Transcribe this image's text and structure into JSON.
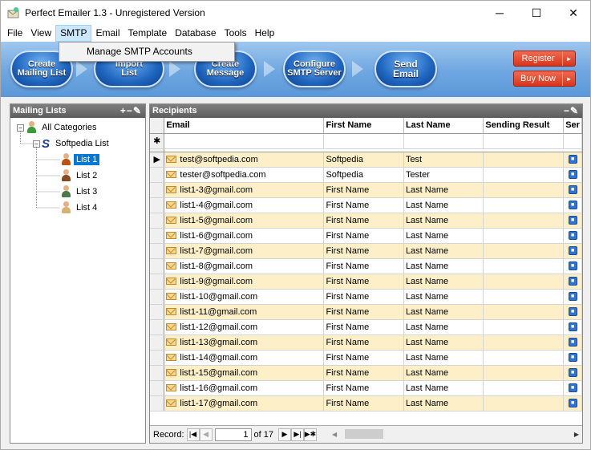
{
  "window": {
    "title": "Perfect Emailer 1.3 - Unregistered Version",
    "minimize": "─",
    "maximize": "☐",
    "close": "✕"
  },
  "menu": [
    "File",
    "View",
    "SMTP",
    "Email",
    "Template",
    "Database",
    "Tools",
    "Help"
  ],
  "smtp_dropdown": {
    "item": "Manage SMTP Accounts"
  },
  "toolbar": {
    "buttons": [
      "Create\nMailing List",
      "Import\nList",
      "Create\nMessage",
      "Configure\nSMTP Server",
      "Send\nEmail"
    ],
    "register": "Register",
    "buy_now": "Buy Now"
  },
  "mailing_lists": {
    "title": "Mailing Lists",
    "tools": "+−✎",
    "tree": {
      "root": "All Categories",
      "group": "Softpedia List",
      "lists": [
        "List 1",
        "List 2",
        "List 3",
        "List 4"
      ],
      "selected": "List 1"
    }
  },
  "recipients": {
    "title": "Recipients",
    "tools": "−✎",
    "columns": [
      "Email",
      "First Name",
      "Last Name",
      "Sending Result",
      "Ser"
    ],
    "new_row_marker": "✱",
    "current_row_marker": "▶",
    "rows": [
      {
        "email": "test@softpedia.com",
        "first": "Softpedia",
        "last": "Test"
      },
      {
        "email": "tester@softpedia.com",
        "first": "Softpedia",
        "last": "Tester"
      },
      {
        "email": "list1-3@gmail.com",
        "first": "First Name",
        "last": "Last Name"
      },
      {
        "email": "list1-4@gmail.com",
        "first": "First Name",
        "last": "Last Name"
      },
      {
        "email": "list1-5@gmail.com",
        "first": "First Name",
        "last": "Last Name"
      },
      {
        "email": "list1-6@gmail.com",
        "first": "First Name",
        "last": "Last Name"
      },
      {
        "email": "list1-7@gmail.com",
        "first": "First Name",
        "last": "Last Name"
      },
      {
        "email": "list1-8@gmail.com",
        "first": "First Name",
        "last": "Last Name"
      },
      {
        "email": "list1-9@gmail.com",
        "first": "First Name",
        "last": "Last Name"
      },
      {
        "email": "list1-10@gmail.com",
        "first": "First Name",
        "last": "Last Name"
      },
      {
        "email": "list1-11@gmail.com",
        "first": "First Name",
        "last": "Last Name"
      },
      {
        "email": "list1-12@gmail.com",
        "first": "First Name",
        "last": "Last Name"
      },
      {
        "email": "list1-13@gmail.com",
        "first": "First Name",
        "last": "Last Name"
      },
      {
        "email": "list1-14@gmail.com",
        "first": "First Name",
        "last": "Last Name"
      },
      {
        "email": "list1-15@gmail.com",
        "first": "First Name",
        "last": "Last Name"
      },
      {
        "email": "list1-16@gmail.com",
        "first": "First Name",
        "last": "Last Name"
      },
      {
        "email": "list1-17@gmail.com",
        "first": "First Name",
        "last": "Last Name"
      }
    ]
  },
  "navigator": {
    "label": "Record:",
    "current": "1",
    "of": "of 17",
    "first": "|◀",
    "prev": "◀",
    "next": "▶",
    "last": "▶|",
    "new": "▶✱",
    "scroll_left": "◀",
    "scroll_right": "▶"
  },
  "colors": {
    "accent": "#0078d7",
    "odd_row": "#fdf0c8",
    "register_red": "#d9341a"
  }
}
